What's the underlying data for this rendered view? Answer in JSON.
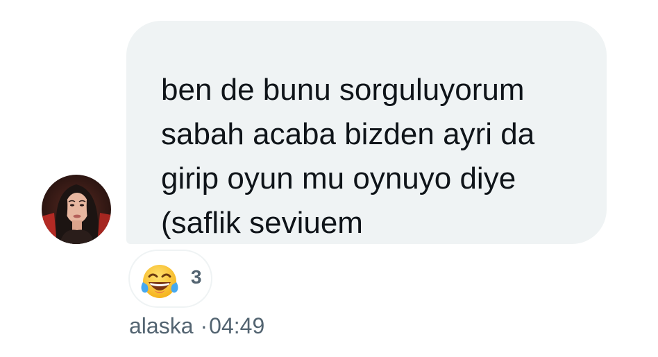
{
  "message": {
    "lines": [
      "ben de bunu sorguluyorum",
      "sabah acaba bizden ayri da",
      "girip oyun mu oynuyo diye",
      "(saflik seviuem"
    ],
    "bubble_color": "#eff3f4",
    "text_color": "#0f1419"
  },
  "reaction": {
    "emoji_icon": "tears-of-joy-emoji",
    "count": "3"
  },
  "meta": {
    "sender": "alaska",
    "separator": "·",
    "time": "04:49",
    "color": "#536471"
  },
  "avatar": {
    "icon": "user-avatar"
  }
}
